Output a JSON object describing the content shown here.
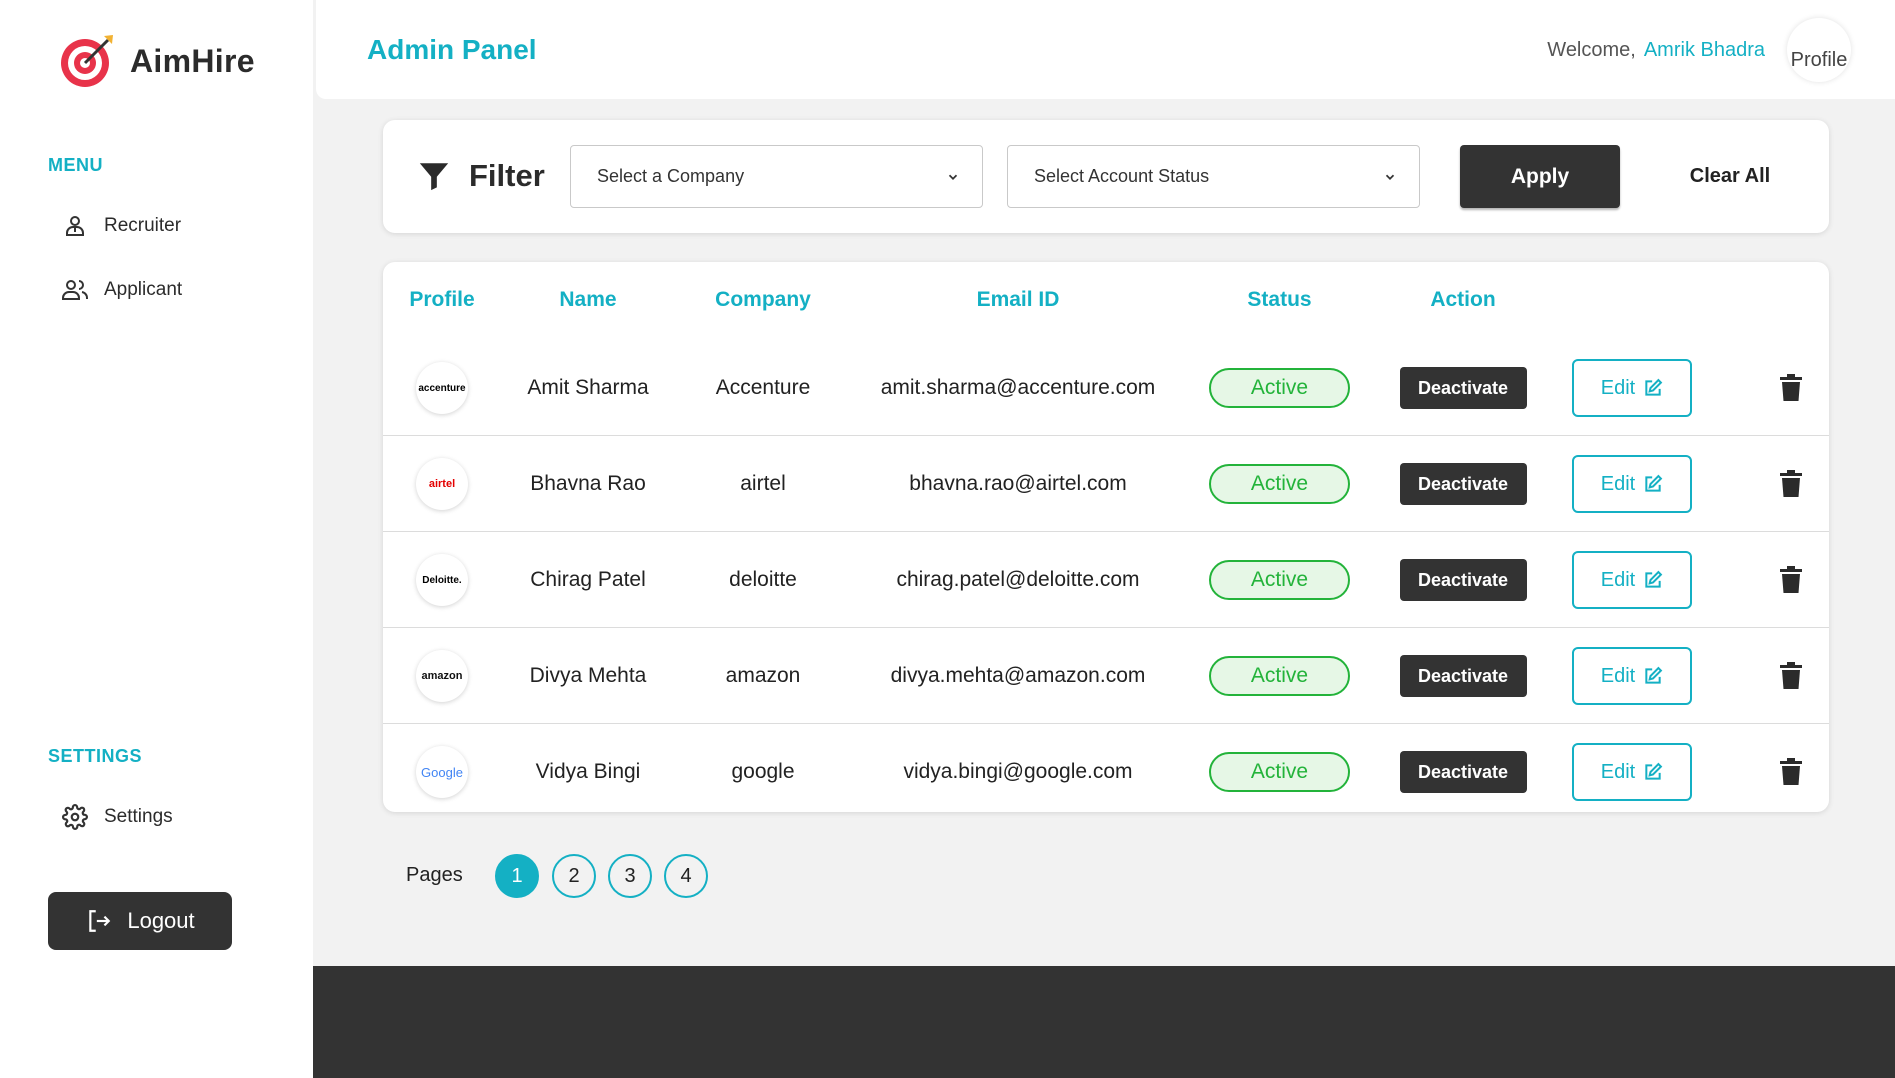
{
  "brand": {
    "name": "AimHire"
  },
  "sidebar": {
    "menu_label": "MENU",
    "items": [
      {
        "label": "Recruiter",
        "icon": "user-tie-icon"
      },
      {
        "label": "Applicant",
        "icon": "users-icon"
      }
    ],
    "settings_label": "SETTINGS",
    "settings_item": {
      "label": "Settings",
      "icon": "gear-icon"
    },
    "logout_label": "Logout"
  },
  "header": {
    "title": "Admin Panel",
    "welcome": "Welcome,",
    "user_name": "Amrik Bhadra",
    "avatar_alt": "Profile"
  },
  "filter": {
    "label": "Filter",
    "company_select": "Select a Company",
    "status_select": "Select Account Status",
    "apply_label": "Apply",
    "clear_label": "Clear All"
  },
  "table": {
    "headers": [
      "Profile",
      "Name",
      "Company",
      "Email ID",
      "Status",
      "Action"
    ],
    "rows": [
      {
        "logo_text": "accenture",
        "name": "Amit Sharma",
        "company": "Accenture",
        "email": "amit.sharma@accenture.com",
        "status": "Active",
        "action": "Deactivate",
        "edit": "Edit"
      },
      {
        "logo_text": "airtel",
        "name": "Bhavna Rao",
        "company": "airtel",
        "email": "bhavna.rao@airtel.com",
        "status": "Active",
        "action": "Deactivate",
        "edit": "Edit"
      },
      {
        "logo_text": "Deloitte.",
        "name": "Chirag Patel",
        "company": "deloitte",
        "email": "chirag.patel@deloitte.com",
        "status": "Active",
        "action": "Deactivate",
        "edit": "Edit"
      },
      {
        "logo_text": "amazon",
        "name": "Divya Mehta",
        "company": "amazon",
        "email": "divya.mehta@amazon.com",
        "status": "Active",
        "action": "Deactivate",
        "edit": "Edit"
      },
      {
        "logo_text": "Google",
        "name": "Vidya Bingi",
        "company": "google",
        "email": "vidya.bingi@google.com",
        "status": "Active",
        "action": "Deactivate",
        "edit": "Edit"
      }
    ]
  },
  "pagination": {
    "label": "Pages",
    "pages": [
      "1",
      "2",
      "3",
      "4"
    ],
    "current": "1"
  },
  "colors": {
    "accent": "#14b0c4",
    "dark": "#333333",
    "status_green": "#23b33a"
  }
}
